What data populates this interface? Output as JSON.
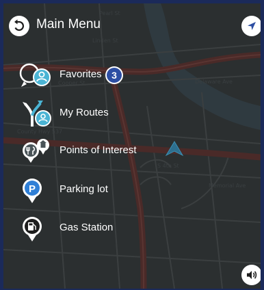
{
  "header": {
    "title": "Main Menu",
    "back_icon": "back-arrow-icon",
    "location_icon": "location-arrow-icon"
  },
  "menu": {
    "items": [
      {
        "label": "Favorites",
        "icon": "favorites-pin-icon",
        "badge": "3"
      },
      {
        "label": "My Routes",
        "icon": "my-routes-icon"
      },
      {
        "label": "Points of Interest",
        "icon": "points-of-interest-icon"
      },
      {
        "label": "Parking lot",
        "icon": "parking-pin-icon"
      },
      {
        "label": "Gas Station",
        "icon": "gas-station-pin-icon"
      }
    ]
  },
  "controls": {
    "sound_icon": "speaker-icon"
  },
  "map": {
    "street_labels": [
      "Cooper St",
      "County Hwy 537",
      "S 4th St",
      "Memorial Ave",
      "Pearl St",
      "Linden St",
      "Delaware Ave"
    ]
  },
  "colors": {
    "map_background": "#2b2f30",
    "road": "#4a2a28",
    "minor_road": "#3b3f40",
    "water": "#2f3a40",
    "frame": "#1b2a5a",
    "accent_blue": "#2d4ea3",
    "teal": "#4ab4d4",
    "vehicle_arrow": "#2d6f8f"
  }
}
